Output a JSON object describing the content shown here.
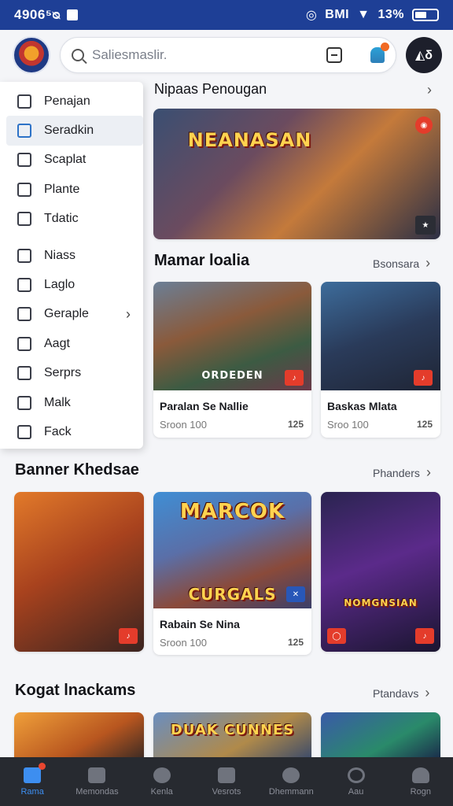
{
  "status_bar": {
    "time": "4906⁵ᴓ",
    "signal_text": "BMI",
    "battery": "13%"
  },
  "search": {
    "placeholder": "Saliesmaslir."
  },
  "avatar": {
    "text": "◭δ"
  },
  "drawer": {
    "items": [
      {
        "label": "Penajan",
        "active": false
      },
      {
        "label": "Seradkin",
        "active": true
      },
      {
        "label": "Scaplat",
        "active": false
      },
      {
        "label": "Plante",
        "active": false
      },
      {
        "label": "Tdatic",
        "active": false
      },
      {
        "label": "Niass",
        "active": false
      },
      {
        "label": "Laglo",
        "active": false
      },
      {
        "label": "Geraple",
        "active": false,
        "has_submenu": true
      },
      {
        "label": "Aagt",
        "active": false
      },
      {
        "label": "Serprs",
        "active": false
      },
      {
        "label": "Malk",
        "active": false
      },
      {
        "label": "Fack",
        "active": false
      }
    ]
  },
  "sections": {
    "featured": {
      "title": "Nipaas Penougan",
      "art_title": "NEANASAN"
    },
    "section2": {
      "title": "Mamar loalia",
      "link": "Bsonsara",
      "cards": [
        {
          "name": "Paralan Se Nallie",
          "meta": "Sroon 100",
          "art_title": "ORDEDEN",
          "icon": "125"
        },
        {
          "name": "Baskas Mlata",
          "meta": "Sroo 100",
          "art_title": "",
          "icon": "125"
        }
      ]
    },
    "section3": {
      "title": "Banner Khedsae",
      "link": "Phanders",
      "cards": [
        {
          "name": "",
          "meta": "",
          "art_title": ""
        },
        {
          "name": "Rabain Se Nina",
          "meta": "Sroon 100",
          "art_title_top": "MARCOK",
          "art_title": "CURGALS",
          "icon": "125"
        },
        {
          "name": "",
          "meta": "",
          "art_title": "NOMGNSIAN"
        }
      ]
    },
    "section4": {
      "title": "Kogat lnackams",
      "link": "Ptandavs",
      "cards": [
        {
          "art_title": ""
        },
        {
          "art_title": "DUAK CUNNES"
        },
        {
          "art_title": ""
        }
      ]
    }
  },
  "bottom_nav": {
    "items": [
      {
        "label": "Rama",
        "active": true
      },
      {
        "label": "Memondas",
        "active": false
      },
      {
        "label": "Kenla",
        "active": false
      },
      {
        "label": "Vesrots",
        "active": false
      },
      {
        "label": "Dhemmann",
        "active": false
      },
      {
        "label": "Aau",
        "active": false
      },
      {
        "label": "Rogn",
        "active": false
      }
    ]
  },
  "colors": {
    "brand": "#1e3f96",
    "accent": "#3d8ef0",
    "badge": "#e43c2b",
    "nav_bg": "#272a30"
  }
}
